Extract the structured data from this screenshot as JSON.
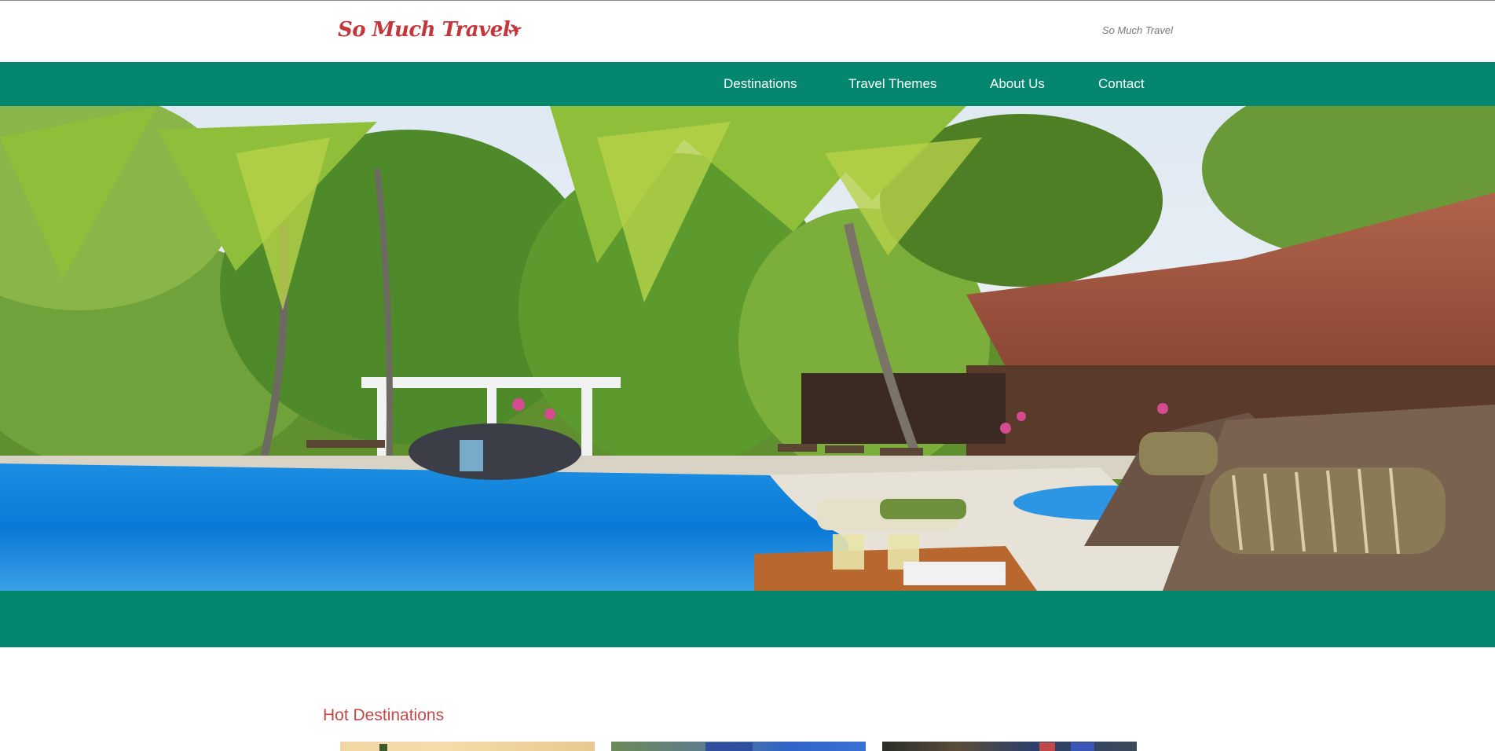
{
  "header": {
    "logo_text": "So Much Travel",
    "logo_icon": "airplane-icon",
    "tagline": "So Much Travel"
  },
  "nav": {
    "items": [
      {
        "label": "Destinations"
      },
      {
        "label": "Travel Themes"
      },
      {
        "label": "About Us"
      },
      {
        "label": "Contact"
      }
    ]
  },
  "hero": {
    "image": "tropical-resort-pool-photo"
  },
  "main": {
    "section_title": "Hot Destinations",
    "cards": [
      {
        "image": "destination-thumbnail-1"
      },
      {
        "image": "destination-thumbnail-2"
      },
      {
        "image": "destination-thumbnail-3"
      }
    ]
  },
  "colors": {
    "brand_green": "#05876f",
    "logo_red": "#c4363a",
    "heading_red": "#c4474a"
  }
}
